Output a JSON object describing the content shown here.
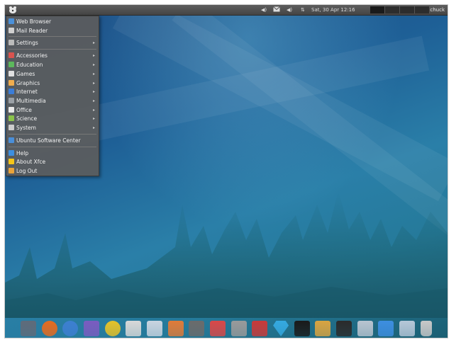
{
  "top_panel": {
    "clock": "Sat, 30 Apr  12:16",
    "username": "chuck",
    "tray_icons": [
      "volume-icon",
      "mail-icon",
      "volume-icon",
      "network-icon"
    ]
  },
  "app_menu": {
    "items": [
      {
        "label": "Web Browser",
        "icon": "web-browser-icon",
        "color": "#4a90d9",
        "submenu": false
      },
      {
        "label": "Mail Reader",
        "icon": "mail-reader-icon",
        "color": "#d0d0d0",
        "submenu": false
      },
      {
        "label": "Settings",
        "icon": "settings-icon",
        "color": "#bbbbbb",
        "submenu": true
      },
      {
        "label": "Accessories",
        "icon": "accessories-icon",
        "color": "#d9534f",
        "submenu": true
      },
      {
        "label": "Education",
        "icon": "education-icon",
        "color": "#5cb85c",
        "submenu": true
      },
      {
        "label": "Games",
        "icon": "games-icon",
        "color": "#e0e0e0",
        "submenu": true
      },
      {
        "label": "Graphics",
        "icon": "graphics-icon",
        "color": "#f0ad4e",
        "submenu": true
      },
      {
        "label": "Internet",
        "icon": "internet-icon",
        "color": "#3b7dd8",
        "submenu": true
      },
      {
        "label": "Multimedia",
        "icon": "multimedia-icon",
        "color": "#9aa0a6",
        "submenu": true
      },
      {
        "label": "Office",
        "icon": "office-icon",
        "color": "#e8e8e8",
        "submenu": true
      },
      {
        "label": "Science",
        "icon": "science-icon",
        "color": "#8bc34a",
        "submenu": true
      },
      {
        "label": "System",
        "icon": "system-icon",
        "color": "#cccccc",
        "submenu": true
      },
      {
        "label": "Ubuntu Software Center",
        "icon": "software-center-icon",
        "color": "#4a8fd9",
        "submenu": false
      },
      {
        "label": "Help",
        "icon": "help-icon",
        "color": "#3d8fe0",
        "submenu": false
      },
      {
        "label": "About Xfce",
        "icon": "about-xfce-icon",
        "color": "#f5c518",
        "submenu": false
      },
      {
        "label": "Log Out",
        "icon": "log-out-icon",
        "color": "#e8a33a",
        "submenu": false
      }
    ]
  },
  "dock": {
    "items": [
      {
        "icon": "show-desktop-icon",
        "color": "#5f6b7a"
      },
      {
        "icon": "firefox-icon",
        "color": "#e66b1f"
      },
      {
        "icon": "thunderbird-icon",
        "color": "#3d7fd1"
      },
      {
        "icon": "pidgin-icon",
        "color": "#7a5cc0"
      },
      {
        "icon": "media-player-icon",
        "color": "#e6c228"
      },
      {
        "icon": "text-editor-icon",
        "color": "#d8d8d8"
      },
      {
        "icon": "document-writer-icon",
        "color": "#c9d4e0"
      },
      {
        "icon": "presentation-icon",
        "color": "#e07b39"
      },
      {
        "icon": "video-icon",
        "color": "#6b6b6b"
      },
      {
        "icon": "image-viewer-icon",
        "color": "#d94848"
      },
      {
        "icon": "settings-gear-icon",
        "color": "#9a9a9a"
      },
      {
        "icon": "network-tool-icon",
        "color": "#c93a3a"
      },
      {
        "icon": "gem-icon",
        "color": "#35a9e0"
      },
      {
        "icon": "terminal-dark-icon",
        "color": "#1a1a1a"
      },
      {
        "icon": "package-icon",
        "color": "#d9a441"
      },
      {
        "icon": "terminal-icon",
        "color": "#2b2b2b"
      },
      {
        "icon": "search-icon",
        "color": "#b8c4d0"
      },
      {
        "icon": "download-icon",
        "color": "#3d8ee0"
      },
      {
        "icon": "folder-icon",
        "color": "#b6c7d8"
      },
      {
        "icon": "trash-icon",
        "color": "#c8c8c8"
      }
    ]
  }
}
